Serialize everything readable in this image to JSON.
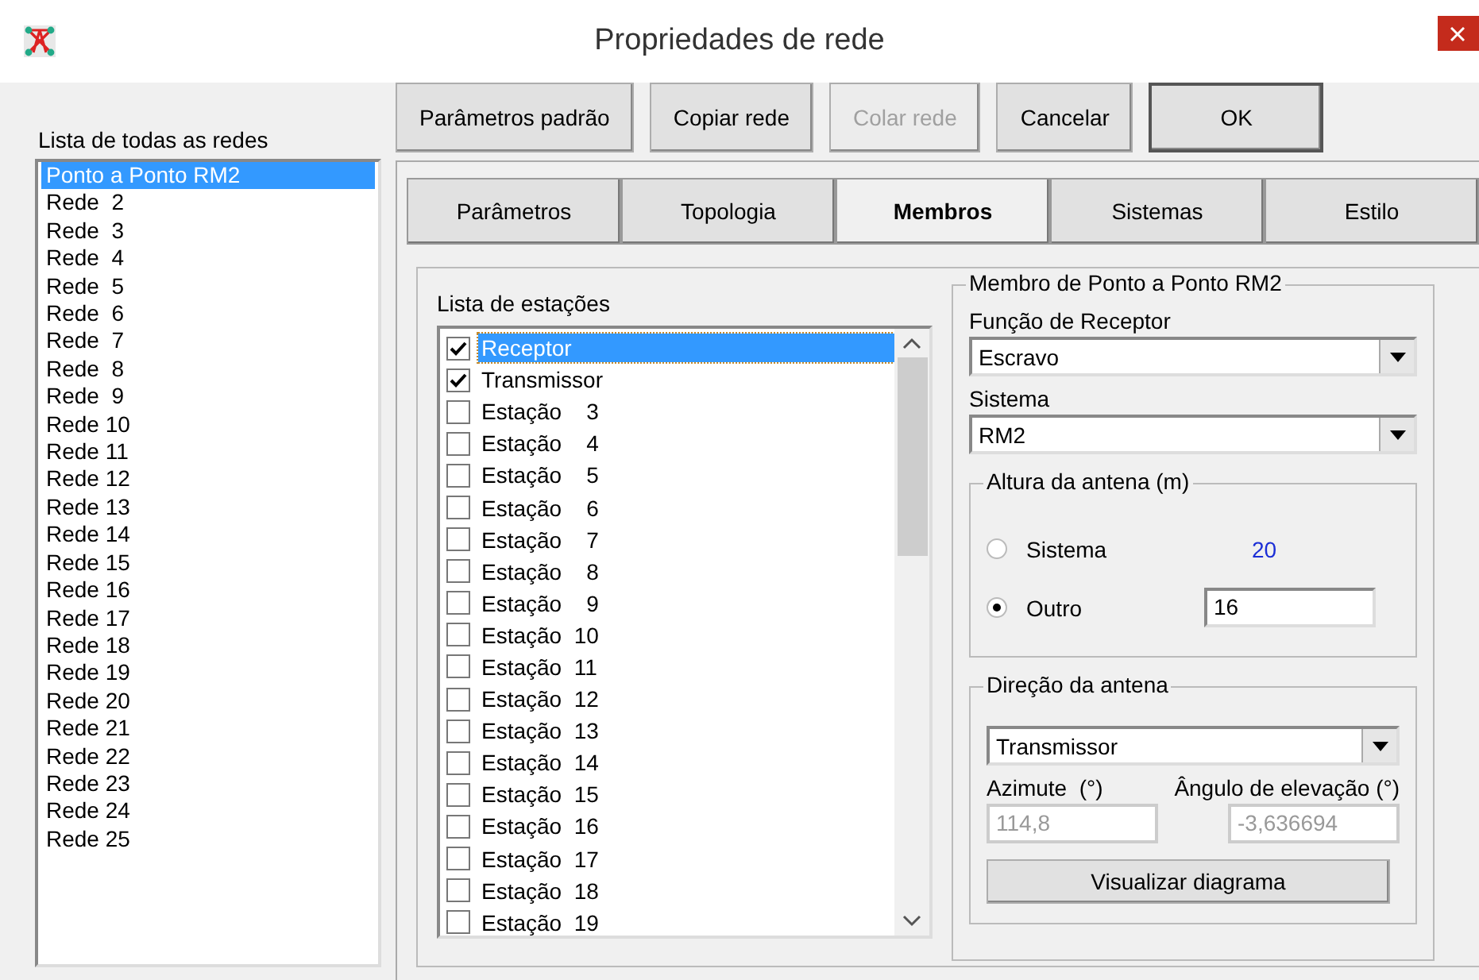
{
  "window": {
    "title": "Propriedades de rede"
  },
  "networks": {
    "label": "Lista de todas as redes",
    "items": [
      {
        "text": "Ponto a Ponto RM2",
        "selected": true
      },
      {
        "text": "Rede  2",
        "selected": false
      },
      {
        "text": "Rede  3",
        "selected": false
      },
      {
        "text": "Rede  4",
        "selected": false
      },
      {
        "text": "Rede  5",
        "selected": false
      },
      {
        "text": "Rede  6",
        "selected": false
      },
      {
        "text": "Rede  7",
        "selected": false
      },
      {
        "text": "Rede  8",
        "selected": false
      },
      {
        "text": "Rede  9",
        "selected": false
      },
      {
        "text": "Rede 10",
        "selected": false
      },
      {
        "text": "Rede 11",
        "selected": false
      },
      {
        "text": "Rede 12",
        "selected": false
      },
      {
        "text": "Rede 13",
        "selected": false
      },
      {
        "text": "Rede 14",
        "selected": false
      },
      {
        "text": "Rede 15",
        "selected": false
      },
      {
        "text": "Rede 16",
        "selected": false
      },
      {
        "text": "Rede 17",
        "selected": false
      },
      {
        "text": "Rede 18",
        "selected": false
      },
      {
        "text": "Rede 19",
        "selected": false
      },
      {
        "text": "Rede 20",
        "selected": false
      },
      {
        "text": "Rede 21",
        "selected": false
      },
      {
        "text": "Rede 22",
        "selected": false
      },
      {
        "text": "Rede 23",
        "selected": false
      },
      {
        "text": "Rede 24",
        "selected": false
      },
      {
        "text": "Rede 25",
        "selected": false
      }
    ]
  },
  "buttons": [
    {
      "label": "Parâmetros padrão",
      "disabled": false
    },
    {
      "label": "Copiar rede",
      "disabled": false
    },
    {
      "label": "Colar rede",
      "disabled": true
    },
    {
      "label": "Cancelar",
      "disabled": false
    },
    {
      "label": "OK",
      "disabled": false
    }
  ],
  "tabs": [
    {
      "label": "Parâmetros",
      "selected": false
    },
    {
      "label": "Topologia",
      "selected": false
    },
    {
      "label": "Membros",
      "selected": true
    },
    {
      "label": "Sistemas",
      "selected": false
    },
    {
      "label": "Estilo",
      "selected": false
    }
  ],
  "stations": {
    "label": "Lista de estações",
    "items": [
      {
        "text": "Receptor",
        "checked": true,
        "selected": true
      },
      {
        "text": "Transmissor",
        "checked": true,
        "selected": false
      },
      {
        "text": "Estação    3",
        "checked": false,
        "selected": false
      },
      {
        "text": "Estação    4",
        "checked": false,
        "selected": false
      },
      {
        "text": "Estação    5",
        "checked": false,
        "selected": false
      },
      {
        "text": "Estação    6",
        "checked": false,
        "selected": false
      },
      {
        "text": "Estação    7",
        "checked": false,
        "selected": false
      },
      {
        "text": "Estação    8",
        "checked": false,
        "selected": false
      },
      {
        "text": "Estação    9",
        "checked": false,
        "selected": false
      },
      {
        "text": "Estação  10",
        "checked": false,
        "selected": false
      },
      {
        "text": "Estação  11",
        "checked": false,
        "selected": false
      },
      {
        "text": "Estação  12",
        "checked": false,
        "selected": false
      },
      {
        "text": "Estação  13",
        "checked": false,
        "selected": false
      },
      {
        "text": "Estação  14",
        "checked": false,
        "selected": false
      },
      {
        "text": "Estação  15",
        "checked": false,
        "selected": false
      },
      {
        "text": "Estação  16",
        "checked": false,
        "selected": false
      },
      {
        "text": "Estação  17",
        "checked": false,
        "selected": false
      },
      {
        "text": "Estação  18",
        "checked": false,
        "selected": false
      },
      {
        "text": "Estação  19",
        "checked": false,
        "selected": false
      }
    ]
  },
  "member": {
    "title": "Membro de Ponto a Ponto RM2",
    "function_label": "Função de Receptor",
    "function_value": "Escravo",
    "system_label": "Sistema",
    "system_value": "RM2",
    "height": {
      "title": "Altura da antena (m)",
      "options": [
        {
          "label": "Sistema",
          "selected": false
        },
        {
          "label": "Outro",
          "selected": true
        }
      ],
      "system_value": "20",
      "other_value": "16"
    },
    "direction": {
      "title": "Direção da antena",
      "target": "Transmissor",
      "azimuth_label": "Azimute  (°)",
      "elevation_label": "Ângulo de elevação (°)",
      "azimuth": "114,8",
      "elevation": "-3,636694",
      "button": "Visualizar diagrama"
    }
  }
}
